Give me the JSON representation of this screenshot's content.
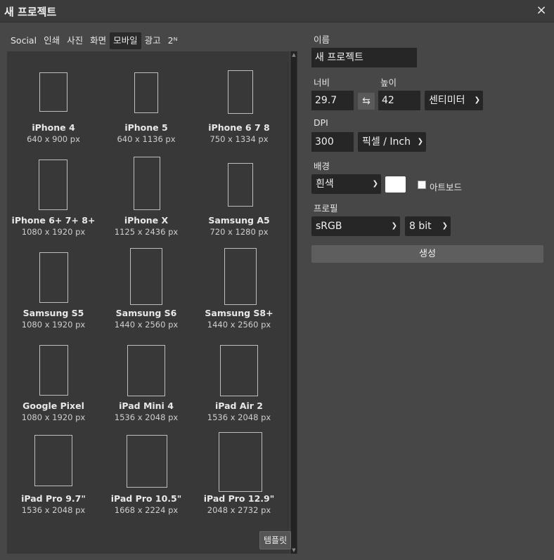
{
  "dialog": {
    "title": "새 프로젝트",
    "close_glyph": "×"
  },
  "tabs": [
    {
      "label": "Social"
    },
    {
      "label": "인쇄"
    },
    {
      "label": "사진"
    },
    {
      "label": "화면"
    },
    {
      "label": "모바일",
      "active": true
    },
    {
      "label": "광고"
    },
    {
      "label": "2ᴺ"
    }
  ],
  "devices": [
    {
      "name": "iPhone 4",
      "size": "640 x 900 px"
    },
    {
      "name": "iPhone 5",
      "size": "640 x 1136 px"
    },
    {
      "name": "iPhone 6 7 8",
      "size": "750 x 1334 px"
    },
    {
      "name": "iPhone 6+ 7+ 8+",
      "size": "1080 x 1920 px"
    },
    {
      "name": "iPhone X",
      "size": "1125 x 2436 px"
    },
    {
      "name": "Samsung A5",
      "size": "720 x 1280 px"
    },
    {
      "name": "Samsung S5",
      "size": "1080 x 1920 px"
    },
    {
      "name": "Samsung S6",
      "size": "1440 x 2560 px"
    },
    {
      "name": "Samsung S8+",
      "size": "1440 x 2560 px"
    },
    {
      "name": "Google Pixel",
      "size": "1080 x 1920 px"
    },
    {
      "name": "iPad Mini 4",
      "size": "1536 x 2048 px"
    },
    {
      "name": "iPad Air 2",
      "size": "1536 x 2048 px"
    },
    {
      "name": "iPad Pro 9.7\"",
      "size": "1536 x 2048 px"
    },
    {
      "name": "iPad Pro 10.5\"",
      "size": "1668 x 2224 px"
    },
    {
      "name": "iPad Pro 12.9\"",
      "size": "2048 x 2732 px"
    }
  ],
  "template_button": "템플릿",
  "form": {
    "name_label": "이름",
    "name_value": "새 프로젝트",
    "width_label": "너비",
    "width_value": "29.7",
    "height_label": "높이",
    "height_value": "42",
    "unit_select": "센티미터",
    "dpi_label": "DPI",
    "dpi_value": "300",
    "dpi_unit_select": "픽셀 / Inch",
    "background_label": "배경",
    "background_select": "흰색",
    "background_color": "#ffffff",
    "artboard_label": "아트보드",
    "artboard_checked": false,
    "profile_label": "프로필",
    "profile_select": "sRGB",
    "bitdepth_select": "8 bit",
    "create_button": "생성"
  },
  "icons": {
    "swap": "swap-arrows-icon",
    "close": "close-icon",
    "chevron": "chevron-down-icon"
  }
}
